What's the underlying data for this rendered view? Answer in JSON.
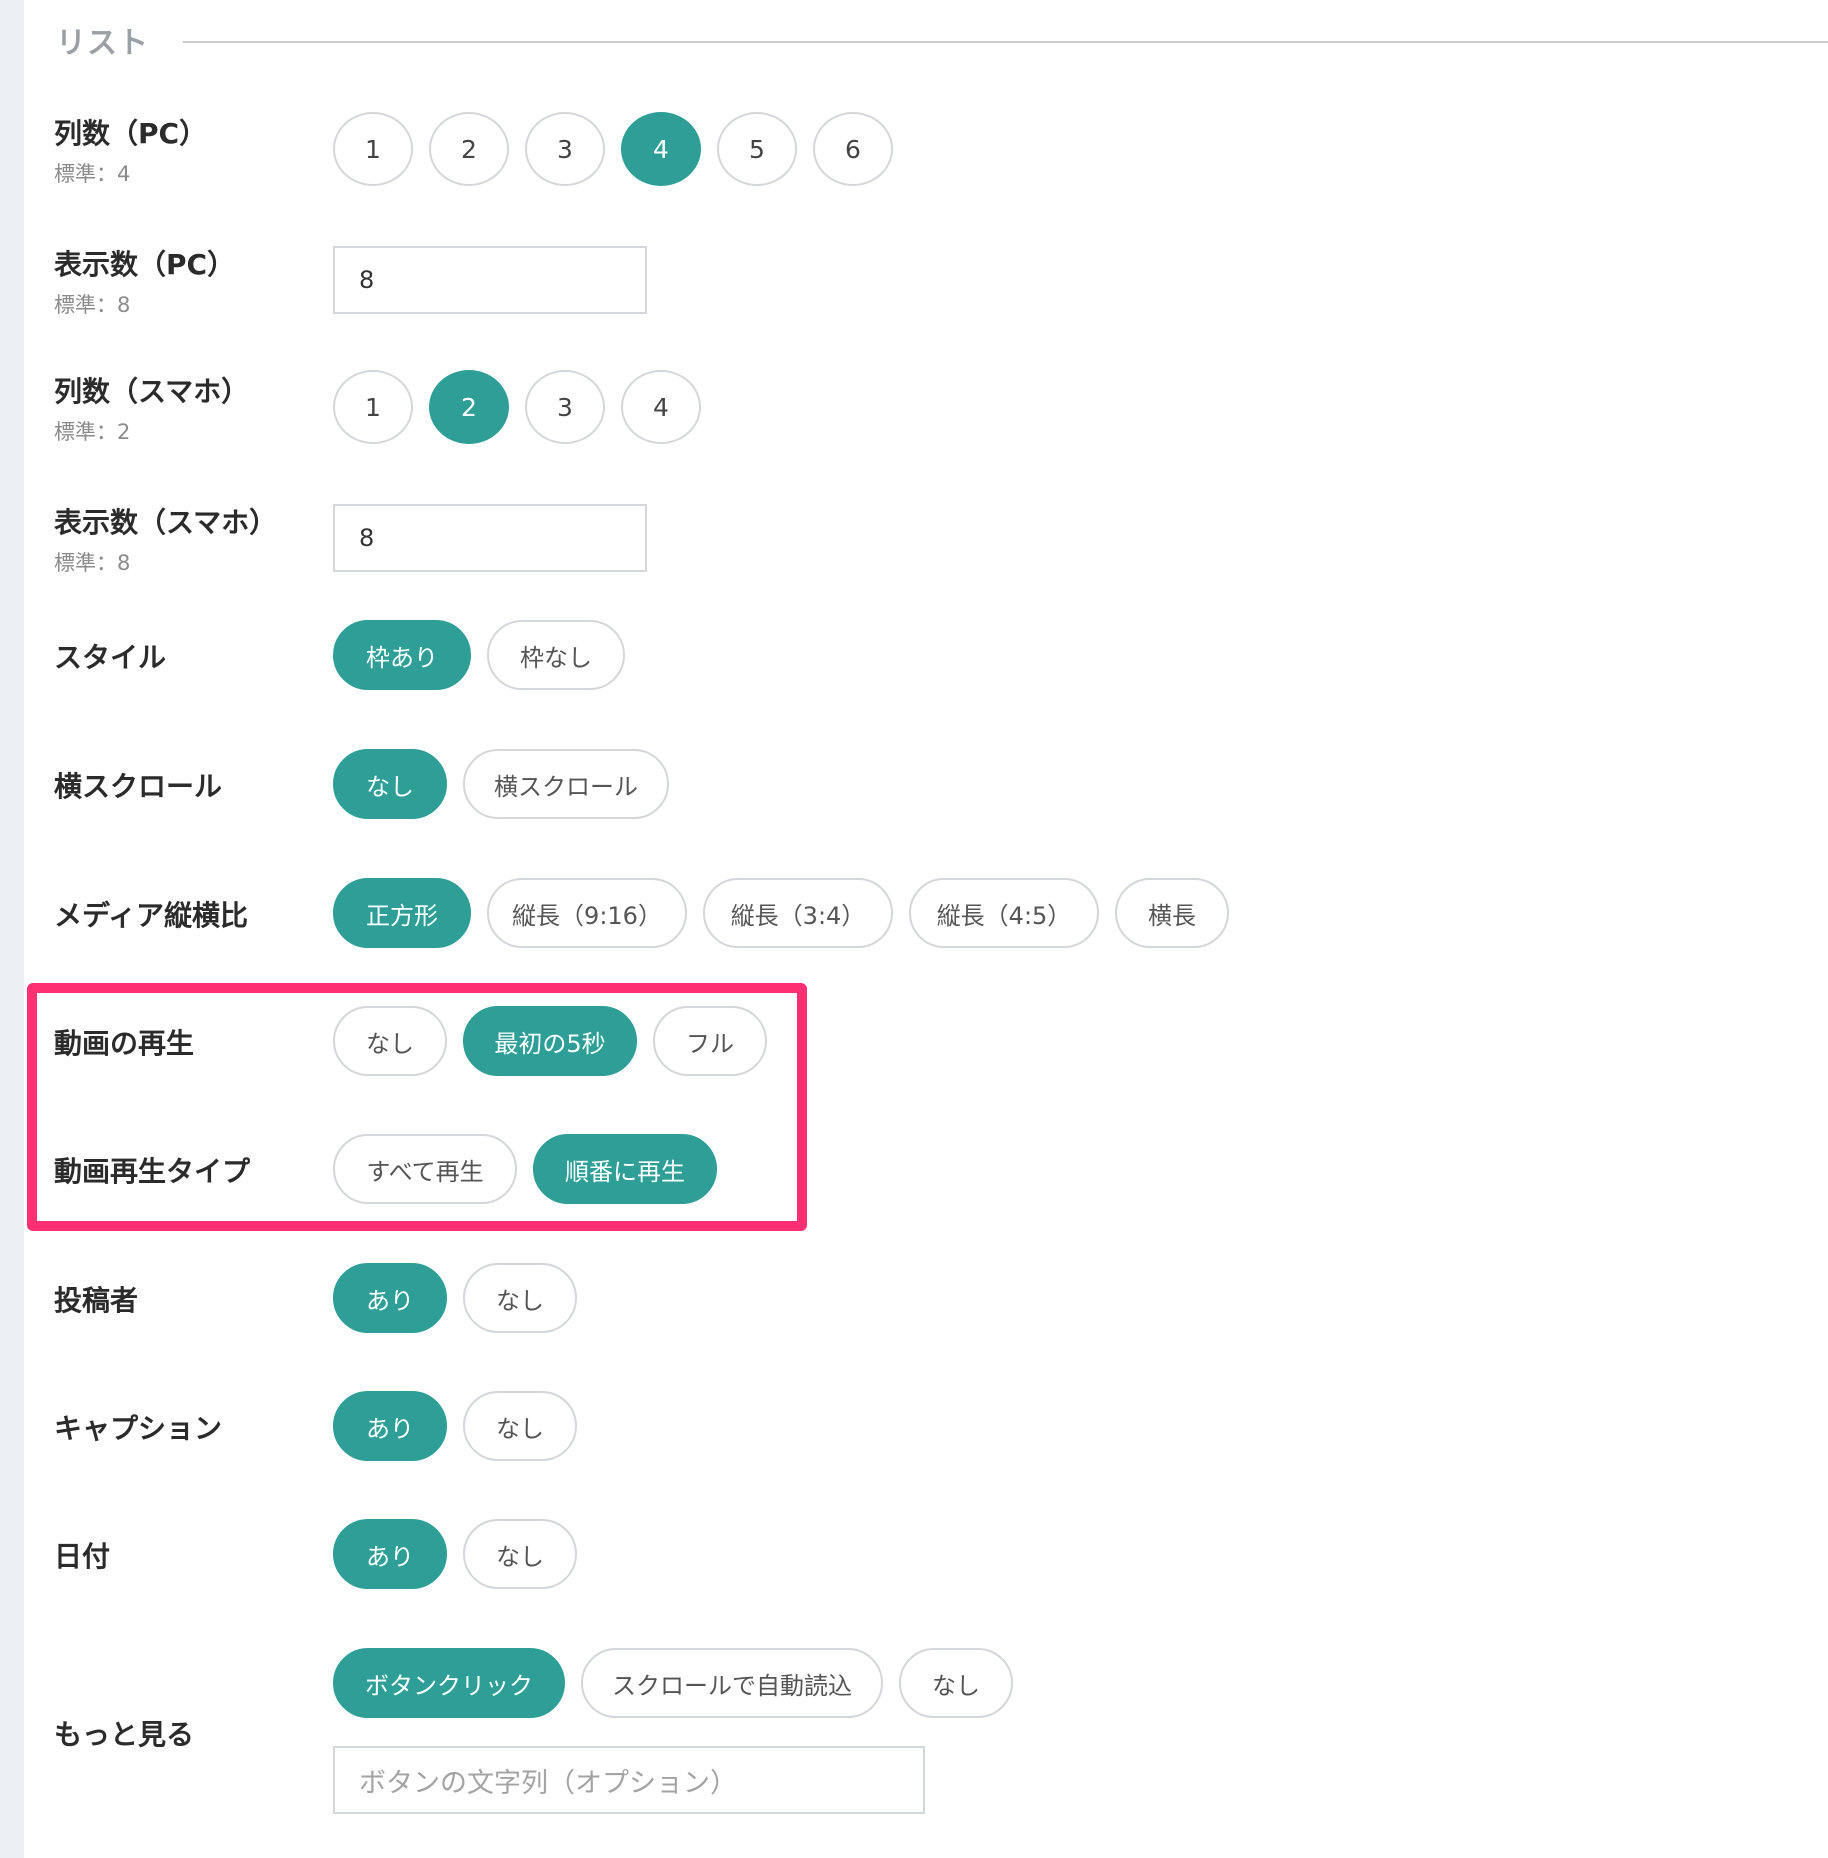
{
  "section": {
    "title": "リスト"
  },
  "columns_pc": {
    "label": "列数（PC）",
    "sub": "標準：4",
    "options": [
      "1",
      "2",
      "3",
      "4",
      "5",
      "6"
    ],
    "selected": "4"
  },
  "count_pc": {
    "label": "表示数（PC）",
    "sub": "標準：8",
    "value": "8"
  },
  "columns_sp": {
    "label": "列数（スマホ）",
    "sub": "標準：2",
    "options": [
      "1",
      "2",
      "3",
      "4"
    ],
    "selected": "2"
  },
  "count_sp": {
    "label": "表示数（スマホ）",
    "sub": "標準：8",
    "value": "8"
  },
  "style": {
    "label": "スタイル",
    "options": [
      "枠あり",
      "枠なし"
    ],
    "selected": "枠あり"
  },
  "h_scroll": {
    "label": "横スクロール",
    "options": [
      "なし",
      "横スクロール"
    ],
    "selected": "なし"
  },
  "aspect": {
    "label": "メディア縦横比",
    "options": [
      "正方形",
      "縦長（9:16）",
      "縦長（3:4）",
      "縦長（4:5）",
      "横長"
    ],
    "selected": "正方形"
  },
  "video_play": {
    "label": "動画の再生",
    "options": [
      "なし",
      "最初の5秒",
      "フル"
    ],
    "selected": "最初の5秒"
  },
  "video_type": {
    "label": "動画再生タイプ",
    "options": [
      "すべて再生",
      "順番に再生"
    ],
    "selected": "順番に再生"
  },
  "author": {
    "label": "投稿者",
    "options": [
      "あり",
      "なし"
    ],
    "selected": "あり"
  },
  "caption": {
    "label": "キャプション",
    "options": [
      "あり",
      "なし"
    ],
    "selected": "あり"
  },
  "date": {
    "label": "日付",
    "options": [
      "あり",
      "なし"
    ],
    "selected": "あり"
  },
  "more": {
    "label": "もっと見る",
    "options": [
      "ボタンクリック",
      "スクロールで自動読込",
      "なし"
    ],
    "selected": "ボタンクリック",
    "button_text_placeholder": "ボタンの文字列（オプション）"
  },
  "colors": {
    "accent": "#2e9e96",
    "highlight": "#ff2f73",
    "border": "#d3d6da"
  }
}
